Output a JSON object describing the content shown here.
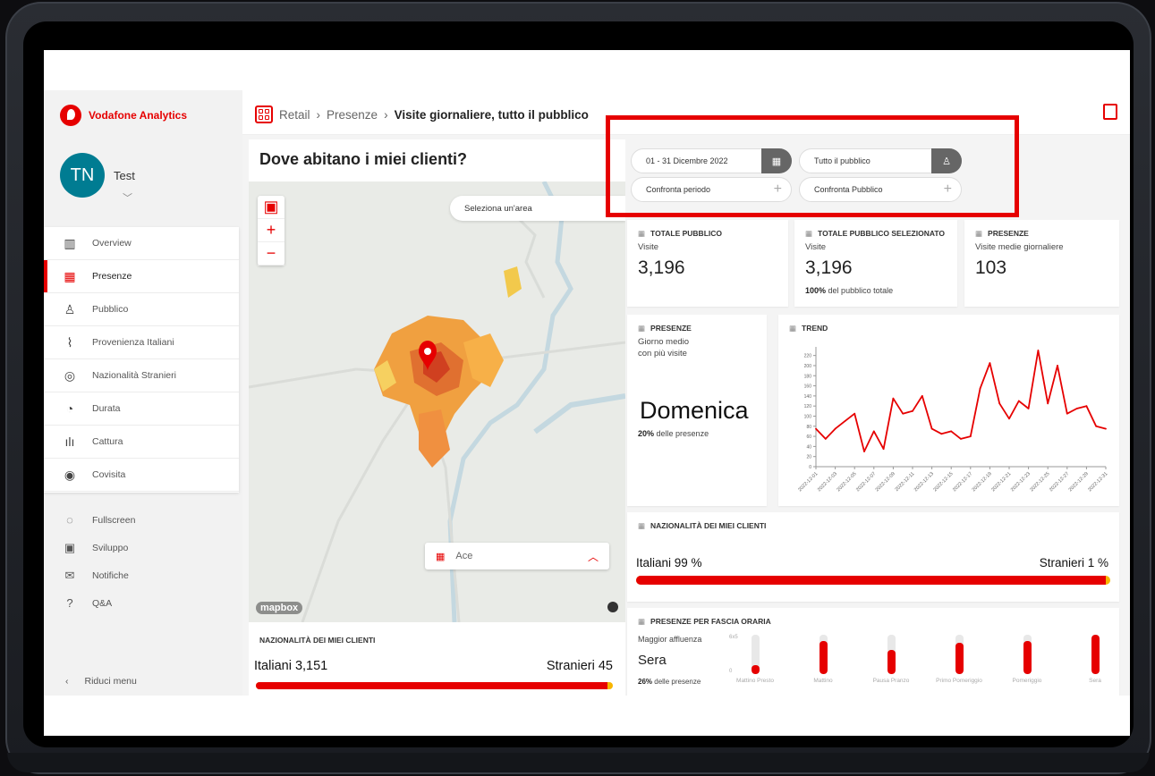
{
  "brand": {
    "name": "Vodafone Analytics"
  },
  "user": {
    "initials": "TN",
    "name": "Test"
  },
  "nav": [
    {
      "label": "Overview",
      "icon": "bar-chart-icon"
    },
    {
      "label": "Presenze",
      "icon": "calendar-icon",
      "active": true
    },
    {
      "label": "Pubblico",
      "icon": "people-icon"
    },
    {
      "label": "Provenienza Italiani",
      "icon": "italy-icon"
    },
    {
      "label": "Nazionalità Stranieri",
      "icon": "globe-icon"
    },
    {
      "label": "Durata",
      "icon": "clock-icon"
    },
    {
      "label": "Cattura",
      "icon": "signal-icon"
    },
    {
      "label": "Covisita",
      "icon": "eye-icon"
    }
  ],
  "util": [
    {
      "label": "Fullscreen",
      "icon": "fullscreen-icon"
    },
    {
      "label": "Sviluppo",
      "icon": "developer-icon"
    },
    {
      "label": "Notifiche",
      "icon": "mail-icon"
    },
    {
      "label": "Q&A",
      "icon": "help-icon"
    }
  ],
  "collapse_label": "Riduci menu",
  "breadcrumb": {
    "root": "Retail",
    "mid": "Presenze",
    "current": "Visite giornaliere, tutto il pubblico"
  },
  "map": {
    "title": "Dove abitano i miei clienti?",
    "select_area": "Seleziona un'area",
    "layer": "Ace",
    "attribution": "mapbox"
  },
  "filters": {
    "date": "01 - 31 Dicembre 2022",
    "audience": "Tutto il pubblico",
    "compare_period": "Confronta periodo",
    "compare_audience": "Confronta Pubblico"
  },
  "cards": {
    "totale": {
      "title": "TOTALE PUBBLICO",
      "sub": "Visite",
      "value": "3,196"
    },
    "selezionato": {
      "title": "TOTALE PUBBLICO SELEZIONATO",
      "sub": "Visite",
      "value": "3,196",
      "pct": "100%",
      "pct_note": "del pubblico totale"
    },
    "presenze": {
      "title": "PRESENZE",
      "sub": "Visite medie giornaliere",
      "value": "103"
    },
    "giorno": {
      "title": "PRESENZE",
      "sub1": "Giorno medio",
      "sub2": "con più visite",
      "value": "Domenica",
      "pct": "20%",
      "pct_note": "delle presenze"
    },
    "trend": {
      "title": "TREND"
    }
  },
  "nationality_map": {
    "title": "NAZIONALITÀ DEI MIEI CLIENTI",
    "left": "Italiani  3,151",
    "right": "Stranieri 45",
    "share": 0.986
  },
  "nationality": {
    "title": "NAZIONALITÀ DEI MIEI CLIENTI",
    "left": "Italiani  99 %",
    "right": "Stranieri  1 %",
    "share": 0.99
  },
  "fascia": {
    "title": "PRESENZE PER FASCIA ORARIA",
    "label1": "Maggior affluenza",
    "label2": "Sera",
    "pct": "26%",
    "pct_note": "delle presenze",
    "axis_top": "6x5",
    "axis_bot": "0",
    "slots": [
      {
        "label": "Mattino Presto",
        "value": 0.22
      },
      {
        "label": "Mattino",
        "value": 0.85
      },
      {
        "label": "Pausa Pranzo",
        "value": 0.62
      },
      {
        "label": "Primo Pomeriggio",
        "value": 0.8
      },
      {
        "label": "Pomeriggio",
        "value": 0.85
      },
      {
        "label": "Sera",
        "value": 1.0
      }
    ]
  },
  "chart_data": {
    "type": "line",
    "title": "TREND",
    "x": [
      "2022-12-01",
      "2022-12-02",
      "2022-12-03",
      "2022-12-04",
      "2022-12-05",
      "2022-12-06",
      "2022-12-07",
      "2022-12-08",
      "2022-12-09",
      "2022-12-10",
      "2022-12-11",
      "2022-12-12",
      "2022-12-13",
      "2022-12-14",
      "2022-12-15",
      "2022-12-16",
      "2022-12-17",
      "2022-12-18",
      "2022-12-19",
      "2022-12-20",
      "2022-12-21",
      "2022-12-22",
      "2022-12-23",
      "2022-12-24",
      "2022-12-25",
      "2022-12-26",
      "2022-12-27",
      "2022-12-28",
      "2022-12-29",
      "2022-12-30",
      "2022-12-31"
    ],
    "x_ticks": [
      "2022-12-01",
      "2022-12-03",
      "2022-12-05",
      "2022-12-07",
      "2022-12-09",
      "2022-12-11",
      "2022-12-13",
      "2022-12-15",
      "2022-12-17",
      "2022-12-19",
      "2022-12-21",
      "2022-12-23",
      "2022-12-25",
      "2022-12-27",
      "2022-12-29",
      "2022-12-31"
    ],
    "values": [
      75,
      55,
      75,
      90,
      105,
      30,
      70,
      35,
      135,
      105,
      110,
      140,
      75,
      65,
      70,
      55,
      60,
      155,
      205,
      125,
      95,
      130,
      115,
      230,
      125,
      200,
      105,
      115,
      120,
      80,
      75
    ],
    "y_ticks": [
      0,
      20,
      40,
      60,
      80,
      100,
      120,
      140,
      160,
      180,
      200,
      220
    ],
    "ylim": [
      0,
      230
    ],
    "color": "#e60000"
  },
  "colors": {
    "accent": "#e60000",
    "avatar": "#007c92",
    "secondary": "#f7b500"
  }
}
